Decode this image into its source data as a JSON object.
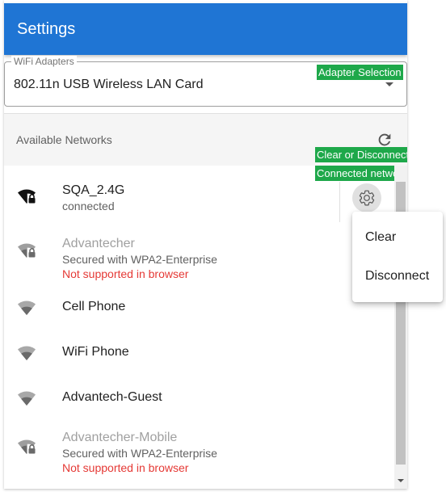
{
  "header": {
    "title": "Settings"
  },
  "adapter": {
    "legend": "WiFi Adapters",
    "value": "802.11n USB Wireless LAN Card",
    "annotation": "Adapter Selection"
  },
  "networks_section": {
    "title": "Available Networks",
    "annotation_line1": "Clear or Disconnect",
    "annotation_line2": "Connected network"
  },
  "networks": [
    {
      "name": "SQA_2.4G",
      "status": "connected",
      "secured": true
    },
    {
      "name": "Advantecher",
      "security": "Secured with WPA2-Enterprise",
      "warning": "Not supported in browser",
      "secured": true
    },
    {
      "name": "Cell Phone",
      "secured": false
    },
    {
      "name": "WiFi Phone",
      "secured": false
    },
    {
      "name": "Advantech-Guest",
      "secured": false
    },
    {
      "name": "Advantecher-Mobile",
      "security": "Secured with WPA2-Enterprise",
      "warning": "Not supported in browser",
      "secured": true
    }
  ],
  "context_menu": {
    "items": [
      {
        "label": "Clear"
      },
      {
        "label": "Disconnect"
      }
    ]
  },
  "colors": {
    "appbar": "#1f75d4",
    "annotation": "#1ea84a",
    "warning": "#e53935",
    "muted": "#a0a0a0"
  }
}
